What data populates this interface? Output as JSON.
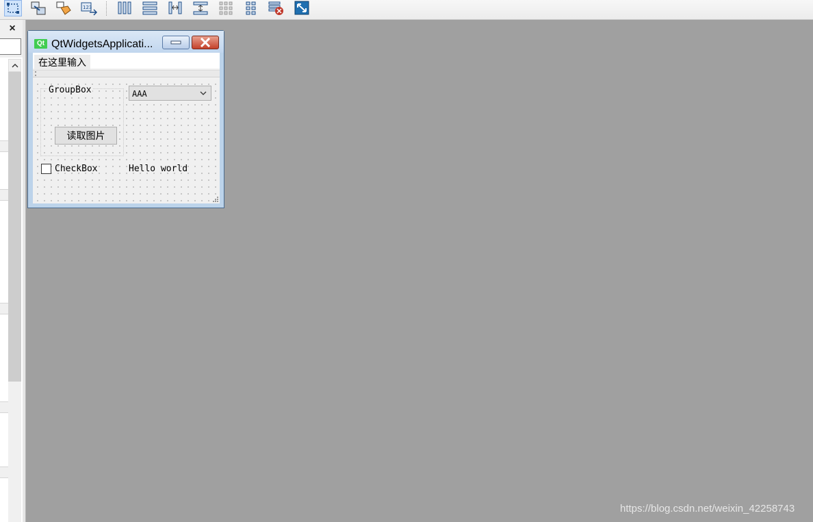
{
  "toolbar": {
    "buttons": [
      {
        "name": "edit-widgets-icon",
        "active": true
      },
      {
        "name": "edit-signals-slots-icon"
      },
      {
        "name": "edit-buddies-icon"
      },
      {
        "name": "edit-tab-order-icon"
      },
      {
        "name": "layout-horizontal-icon"
      },
      {
        "name": "layout-vertical-icon"
      },
      {
        "name": "layout-horizontal-splitter-icon"
      },
      {
        "name": "layout-vertical-splitter-icon"
      },
      {
        "name": "layout-grid-icon"
      },
      {
        "name": "layout-form-icon"
      },
      {
        "name": "break-layout-icon"
      },
      {
        "name": "adjust-size-icon"
      }
    ]
  },
  "dock": {
    "close_glyph": "×"
  },
  "form_window": {
    "title": "QtWidgetsApplicati...",
    "logo_text": "Qt",
    "menu_placeholder": "在这里输入",
    "groupbox_title": "GroupBox",
    "push_button_label": "读取图片",
    "combo_value": "AAA",
    "checkbox_label": "CheckBox",
    "checkbox_checked": false,
    "label_text": "Hello world"
  },
  "watermark": "https://blog.csdn.net/weixin_42258743",
  "colors": {
    "canvas_bg": "#a0a0a0",
    "qt_green": "#41cd52",
    "close_red": "#c4412a"
  }
}
